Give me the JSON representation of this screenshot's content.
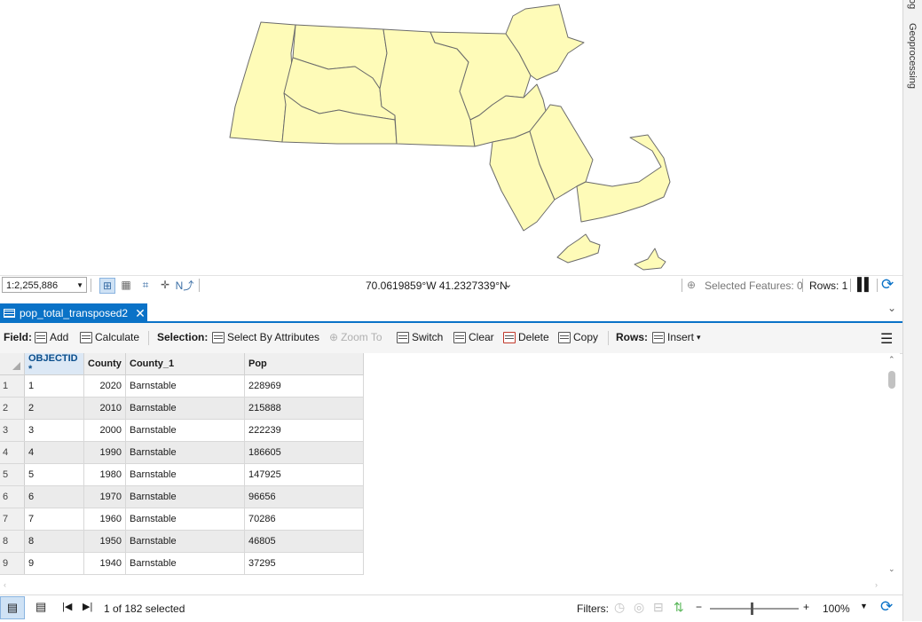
{
  "map": {
    "scale": "1:2,255,886",
    "coordinates": "70.0619859°W 41.2327339°N",
    "selected_features": "Selected Features: 0",
    "rows": "Rows: 1",
    "fill_color": "#fefbb8",
    "stroke_color": "#6b6b6b"
  },
  "side_panel": {
    "partial_label": "og",
    "geoprocessing_label": "Geoprocessing"
  },
  "tab": {
    "title": "pop_total_transposed2"
  },
  "toolbar": {
    "field_label": "Field:",
    "add_label": "Add",
    "calculate_label": "Calculate",
    "selection_label": "Selection:",
    "select_by_attributes_label": "Select By Attributes",
    "zoom_to_label": "Zoom To",
    "switch_label": "Switch",
    "clear_label": "Clear",
    "delete_label": "Delete",
    "copy_label": "Copy",
    "rows_label": "Rows:",
    "insert_label": "Insert"
  },
  "table": {
    "columns": [
      "OBJECTID *",
      "County",
      "County_1",
      "Pop"
    ],
    "rows": [
      {
        "n": "1",
        "objectid": "1",
        "county": "2020",
        "county_1": "Barnstable",
        "pop": "228969"
      },
      {
        "n": "2",
        "objectid": "2",
        "county": "2010",
        "county_1": "Barnstable",
        "pop": "215888"
      },
      {
        "n": "3",
        "objectid": "3",
        "county": "2000",
        "county_1": "Barnstable",
        "pop": "222239"
      },
      {
        "n": "4",
        "objectid": "4",
        "county": "1990",
        "county_1": "Barnstable",
        "pop": "186605"
      },
      {
        "n": "5",
        "objectid": "5",
        "county": "1980",
        "county_1": "Barnstable",
        "pop": "147925"
      },
      {
        "n": "6",
        "objectid": "6",
        "county": "1970",
        "county_1": "Barnstable",
        "pop": "96656"
      },
      {
        "n": "7",
        "objectid": "7",
        "county": "1960",
        "county_1": "Barnstable",
        "pop": "70286"
      },
      {
        "n": "8",
        "objectid": "8",
        "county": "1950",
        "county_1": "Barnstable",
        "pop": "46805"
      },
      {
        "n": "9",
        "objectid": "9",
        "county": "1940",
        "county_1": "Barnstable",
        "pop": "37295"
      }
    ]
  },
  "status": {
    "selection_text": "1 of 182 selected",
    "filters_label": "Filters:",
    "zoom_level": "100%"
  },
  "colors": {
    "accent": "#0a72c7"
  }
}
